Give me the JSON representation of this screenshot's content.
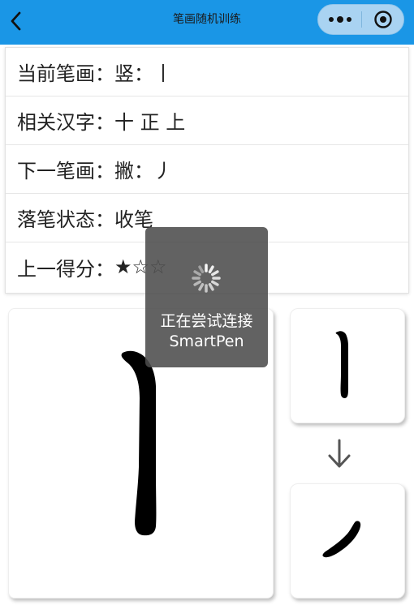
{
  "navbar": {
    "title": "笔画随机训练",
    "back_icon": "chevron-left-icon",
    "more_icon": "more-dots-icon",
    "close_icon": "target-close-icon",
    "background": "#1a96e6"
  },
  "info": {
    "current_stroke": {
      "label": "当前笔画：",
      "value": "竖：丨"
    },
    "related_chars": {
      "label": "相关汉字：",
      "value": "十 正 上"
    },
    "next_stroke": {
      "label": "下一笔画：",
      "value": "撇：丿"
    },
    "pen_state": {
      "label": "落笔状态：",
      "value": "收笔"
    },
    "last_score": {
      "label": "上一得分：",
      "value": "★☆☆"
    }
  },
  "canvas": {
    "current_glyph": "丨",
    "preview_current": "丨",
    "preview_next": "丿",
    "arrow_icon": "arrow-down-icon"
  },
  "toast": {
    "text_line1": "正在尝试连接",
    "text_line2": "SmartPen",
    "icon": "loading-spinner-icon"
  }
}
